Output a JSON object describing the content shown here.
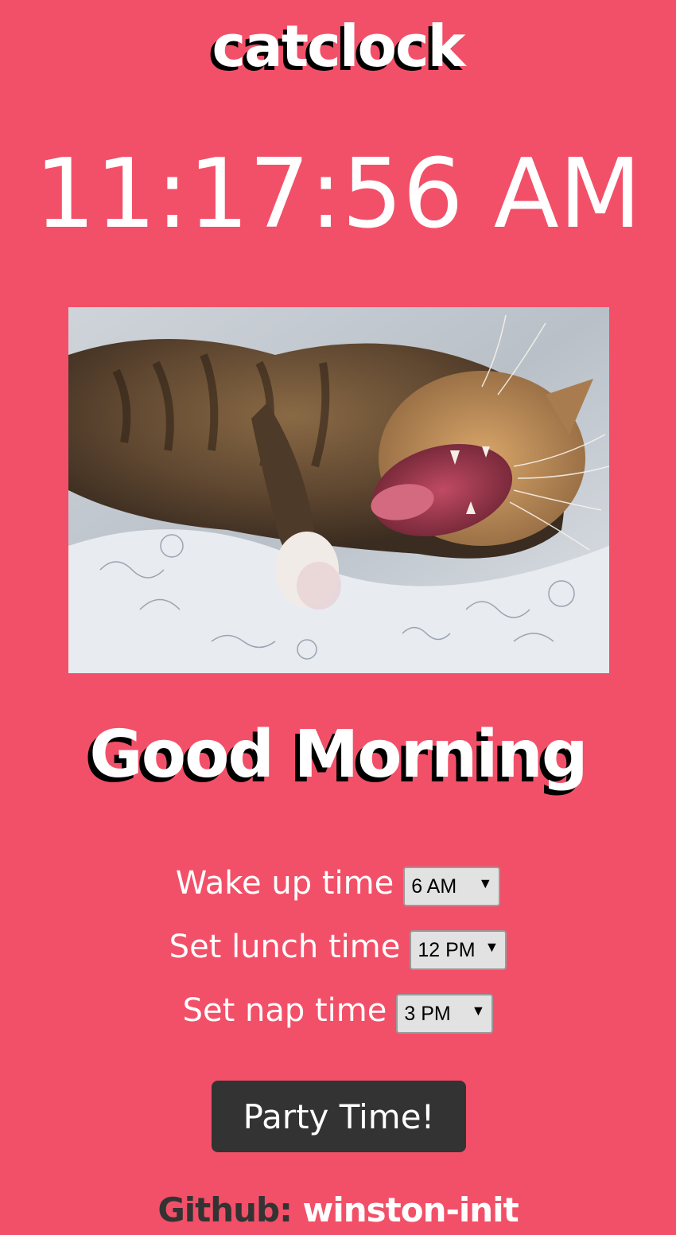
{
  "header": {
    "brand": "catclock"
  },
  "clock": {
    "time": "11:17:56 AM"
  },
  "greeting": "Good Morning",
  "settings": [
    {
      "label": "Wake up time",
      "value": "6 AM"
    },
    {
      "label": "Set lunch time",
      "value": "12 PM"
    },
    {
      "label": "Set nap time",
      "value": "3 PM"
    }
  ],
  "party_button": "Party Time!",
  "footer": {
    "prefix": "Github:",
    "username": "winston-init"
  },
  "colors": {
    "background": "#f25068",
    "button": "#333333",
    "text": "#ffffff"
  },
  "icons": {
    "select_arrow": "dropdown-arrow-icon"
  }
}
